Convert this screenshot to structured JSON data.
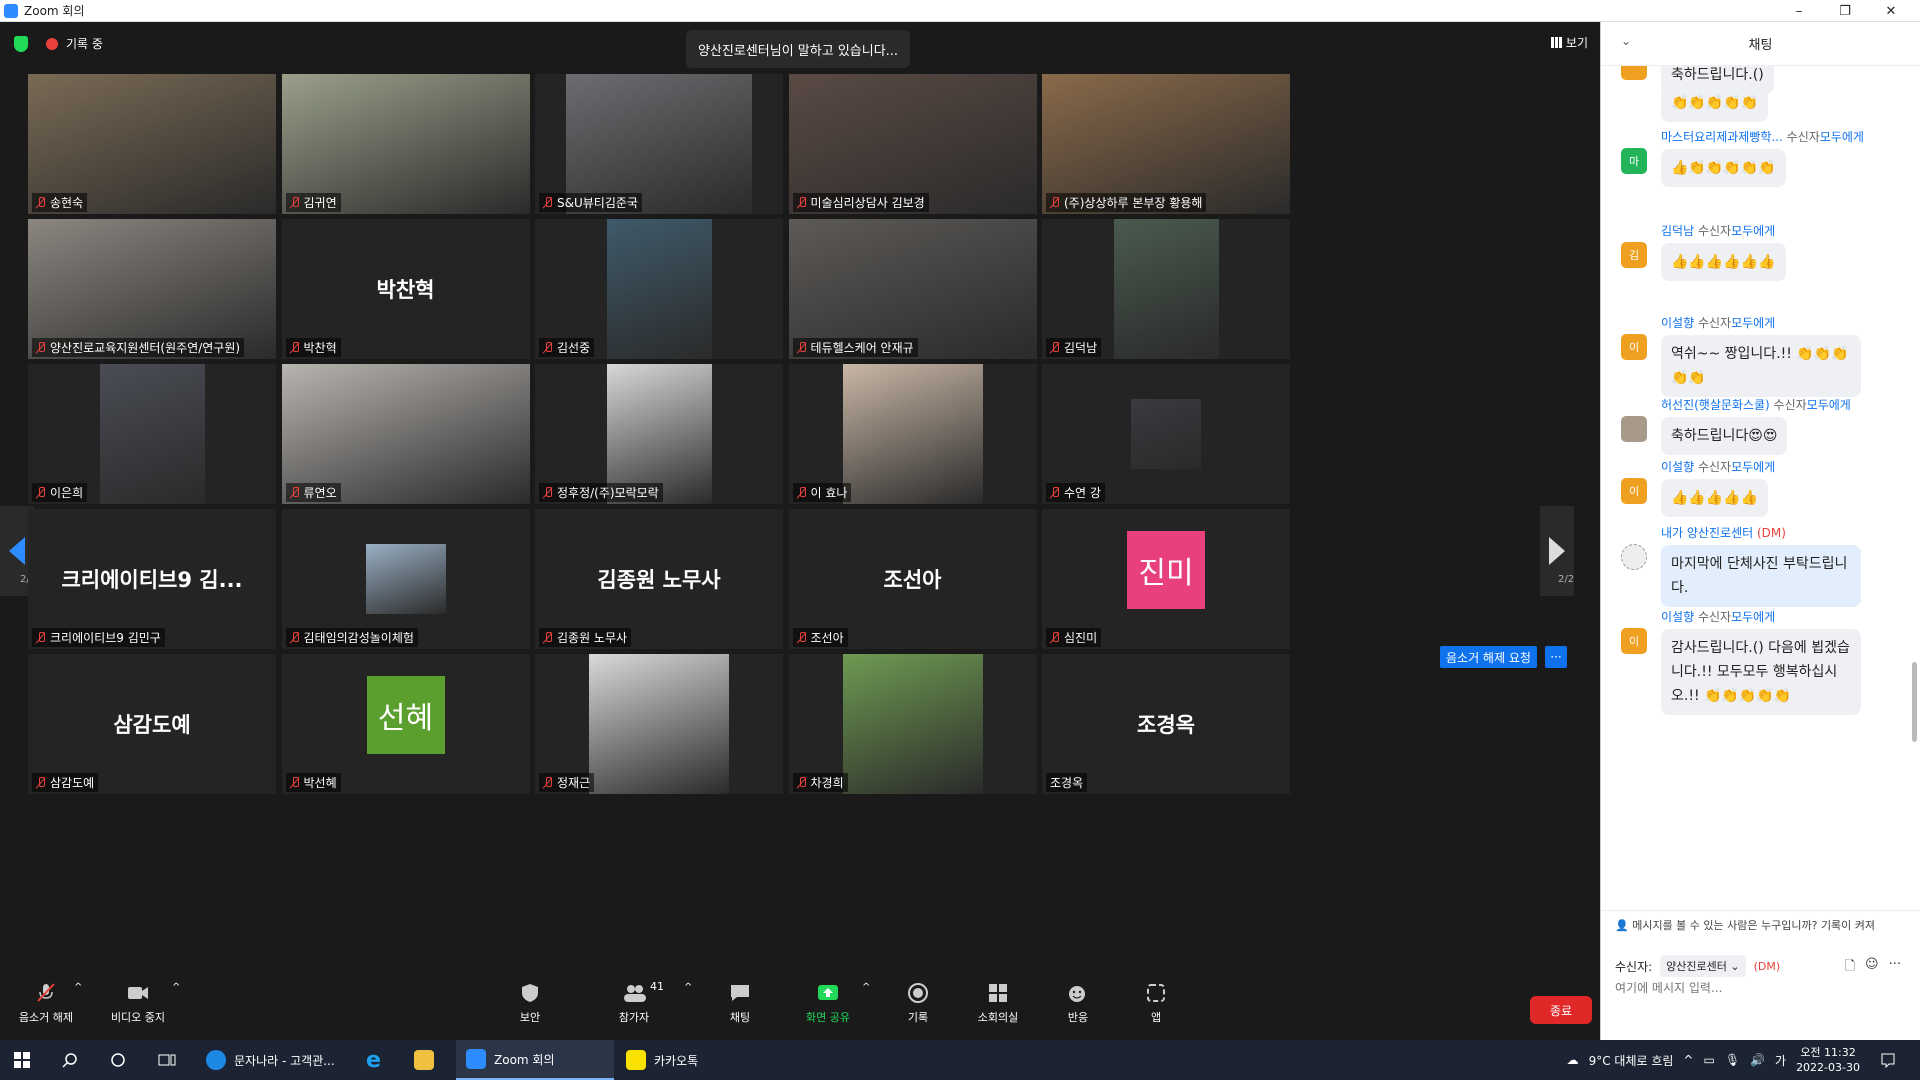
{
  "window": {
    "title": "Zoom 회의",
    "minimize": "–",
    "maximize": "❐",
    "close": "✕"
  },
  "topbar": {
    "recording": "기록 중",
    "speaking": "양산진로센터님이 말하고 있습니다...",
    "view": "보기"
  },
  "pager": {
    "left": "2/2",
    "right": "2/2"
  },
  "tiles": [
    {
      "name": "송현숙",
      "color": "#7a6a55"
    },
    {
      "name": "김귀연",
      "color": "#9aa08a"
    },
    {
      "name": "S&U뷰티김준국",
      "color": "#6b6d70"
    },
    {
      "name": "미술심리상담사 김보경",
      "color": "#5a4a44"
    },
    {
      "name": "(주)상상하루 본부장 황용해",
      "color": "#8a6a4a"
    },
    {
      "name": "양산진로교육지원센터(원주연/연구원)",
      "color": "#8b8680"
    },
    {
      "name": "박찬혁",
      "big": "박찬혁"
    },
    {
      "name": "김선중",
      "color": "#3f5a6a"
    },
    {
      "name": "테듀헬스케어 안재규",
      "color": "#5d5a57"
    },
    {
      "name": "김덕남",
      "color": "#4a5a4f"
    },
    {
      "name": "이은희",
      "color": "#4a4d55"
    },
    {
      "name": "류연오",
      "color": "#b8b4b0"
    },
    {
      "name": "정후정/(주)모락모락",
      "color": "#d8d8d8"
    },
    {
      "name": "이 효나",
      "color": "#c9b7a6"
    },
    {
      "name": "수연 강",
      "color": "#3a3a40"
    },
    {
      "name": "크리에이티브9 김민구",
      "big": "크리에이티브9 김..."
    },
    {
      "name": "김태임의감성놀이체험",
      "color": "#9ab0c4"
    },
    {
      "name": "김종원 노무사",
      "big": "김종원 노무사"
    },
    {
      "name": "조선아",
      "big": "조선아"
    },
    {
      "name": "심진미",
      "avatar": "진미",
      "avatar_color": "#e8407c"
    },
    {
      "name": "삼감도예",
      "big": "삼감도예"
    },
    {
      "name": "박선혜",
      "avatar": "선혜",
      "avatar_color": "#5b9f2e"
    },
    {
      "name": "정재근",
      "color": "#d9d9d9"
    },
    {
      "name": "차경희",
      "color": "#6f9a52"
    },
    {
      "name": "조경옥",
      "big": "조경옥",
      "no_mic": true
    }
  ],
  "tile_actions": {
    "unmute_request": "음소거 해제 요청",
    "more": "···"
  },
  "toolbar": {
    "unmute": "음소거 해제",
    "stop_video": "비디오 중지",
    "security": "보안",
    "participants": "참가자",
    "participant_count": "41",
    "chat": "채팅",
    "share": "화면 공유",
    "record": "기록",
    "breakout": "소회의실",
    "reactions": "반응",
    "apps": "앱",
    "end": "종료"
  },
  "chat": {
    "title": "채팅",
    "messages": [
      {
        "sender": "",
        "to": "",
        "text": "축하드립니다.()",
        "avatar": "",
        "avatar_color": "#f0a020"
      },
      {
        "sender": "",
        "to": "",
        "text": "👏👏👏👏👏",
        "avatar": "",
        "avatar_color": ""
      },
      {
        "sender": "마스터요리제과제빵학...",
        "to": "수신자",
        "target": "모두에게",
        "text": "👍👏👏👏👏👏",
        "avatar": "마",
        "avatar_color": "#23b45a"
      },
      {
        "sender": "김덕남",
        "to": "수신자",
        "target": "모두에게",
        "text": "👍👍👍👍👍👍",
        "avatar": "김",
        "avatar_color": "#f0a020"
      },
      {
        "sender": "이설향",
        "to": "수신자",
        "target": "모두에게",
        "text": "역쉬~~ 짱입니다.!! 👏👏👏👏👏",
        "avatar": "이",
        "avatar_color": "#f0a020"
      },
      {
        "sender": "허선진(햇살문화스쿨)",
        "to": "수신자",
        "target": "모두에게",
        "text": "축하드립니다😍😍",
        "avatar": "",
        "avatar_color": "#a89a8a"
      },
      {
        "sender": "이설향",
        "to": "수신자",
        "target": "모두에게",
        "text": "👍👍👍👍👍",
        "avatar": "이",
        "avatar_color": "#f0a020"
      },
      {
        "sender": "내가",
        "to": "",
        "target": "양산진로센터",
        "dm": "(DM)",
        "text": "마지막에 단체사진 부탁드립니다.",
        "avatar": "",
        "avatar_color": "#cccccc"
      },
      {
        "sender": "이설향",
        "to": "수신자",
        "target": "모두에게",
        "text": "감사드립니다.() 다음에 뵙겠습니다.!! 모두모두 행복하십시오.!! 👏👏👏👏👏",
        "avatar": "이",
        "avatar_color": "#f0a020"
      }
    ],
    "notice": "메시지를 볼 수 있는 사람은 누구입니까? 기록이 켜져",
    "to_label": "수신자:",
    "to_value": "양산진로센터",
    "to_dm": "(DM)",
    "input_placeholder": "여기에 메시지 입력..."
  },
  "taskbar": {
    "app1": "문자나라 - 고객관...",
    "app2": "Zoom 회의",
    "app3": "카카오톡",
    "weather": "9°C 대체로 흐림",
    "ime": "가",
    "time": "오전 11:32",
    "date": "2022-03-30"
  }
}
